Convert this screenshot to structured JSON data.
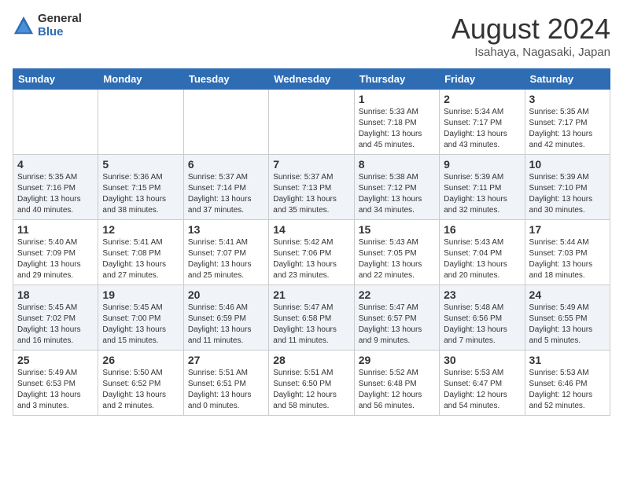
{
  "logo": {
    "general": "General",
    "blue": "Blue"
  },
  "header": {
    "title": "August 2024",
    "subtitle": "Isahaya, Nagasaki, Japan"
  },
  "days": [
    "Sunday",
    "Monday",
    "Tuesday",
    "Wednesday",
    "Thursday",
    "Friday",
    "Saturday"
  ],
  "weeks": [
    [
      {
        "date": "",
        "info": ""
      },
      {
        "date": "",
        "info": ""
      },
      {
        "date": "",
        "info": ""
      },
      {
        "date": "",
        "info": ""
      },
      {
        "date": "1",
        "info": "Sunrise: 5:33 AM\nSunset: 7:18 PM\nDaylight: 13 hours and 45 minutes."
      },
      {
        "date": "2",
        "info": "Sunrise: 5:34 AM\nSunset: 7:17 PM\nDaylight: 13 hours and 43 minutes."
      },
      {
        "date": "3",
        "info": "Sunrise: 5:35 AM\nSunset: 7:17 PM\nDaylight: 13 hours and 42 minutes."
      }
    ],
    [
      {
        "date": "4",
        "info": "Sunrise: 5:35 AM\nSunset: 7:16 PM\nDaylight: 13 hours and 40 minutes."
      },
      {
        "date": "5",
        "info": "Sunrise: 5:36 AM\nSunset: 7:15 PM\nDaylight: 13 hours and 38 minutes."
      },
      {
        "date": "6",
        "info": "Sunrise: 5:37 AM\nSunset: 7:14 PM\nDaylight: 13 hours and 37 minutes."
      },
      {
        "date": "7",
        "info": "Sunrise: 5:37 AM\nSunset: 7:13 PM\nDaylight: 13 hours and 35 minutes."
      },
      {
        "date": "8",
        "info": "Sunrise: 5:38 AM\nSunset: 7:12 PM\nDaylight: 13 hours and 34 minutes."
      },
      {
        "date": "9",
        "info": "Sunrise: 5:39 AM\nSunset: 7:11 PM\nDaylight: 13 hours and 32 minutes."
      },
      {
        "date": "10",
        "info": "Sunrise: 5:39 AM\nSunset: 7:10 PM\nDaylight: 13 hours and 30 minutes."
      }
    ],
    [
      {
        "date": "11",
        "info": "Sunrise: 5:40 AM\nSunset: 7:09 PM\nDaylight: 13 hours and 29 minutes."
      },
      {
        "date": "12",
        "info": "Sunrise: 5:41 AM\nSunset: 7:08 PM\nDaylight: 13 hours and 27 minutes."
      },
      {
        "date": "13",
        "info": "Sunrise: 5:41 AM\nSunset: 7:07 PM\nDaylight: 13 hours and 25 minutes."
      },
      {
        "date": "14",
        "info": "Sunrise: 5:42 AM\nSunset: 7:06 PM\nDaylight: 13 hours and 23 minutes."
      },
      {
        "date": "15",
        "info": "Sunrise: 5:43 AM\nSunset: 7:05 PM\nDaylight: 13 hours and 22 minutes."
      },
      {
        "date": "16",
        "info": "Sunrise: 5:43 AM\nSunset: 7:04 PM\nDaylight: 13 hours and 20 minutes."
      },
      {
        "date": "17",
        "info": "Sunrise: 5:44 AM\nSunset: 7:03 PM\nDaylight: 13 hours and 18 minutes."
      }
    ],
    [
      {
        "date": "18",
        "info": "Sunrise: 5:45 AM\nSunset: 7:02 PM\nDaylight: 13 hours and 16 minutes."
      },
      {
        "date": "19",
        "info": "Sunrise: 5:45 AM\nSunset: 7:00 PM\nDaylight: 13 hours and 15 minutes."
      },
      {
        "date": "20",
        "info": "Sunrise: 5:46 AM\nSunset: 6:59 PM\nDaylight: 13 hours and 11 minutes."
      },
      {
        "date": "21",
        "info": "Sunrise: 5:47 AM\nSunset: 6:58 PM\nDaylight: 13 hours and 11 minutes."
      },
      {
        "date": "22",
        "info": "Sunrise: 5:47 AM\nSunset: 6:57 PM\nDaylight: 13 hours and 9 minutes."
      },
      {
        "date": "23",
        "info": "Sunrise: 5:48 AM\nSunset: 6:56 PM\nDaylight: 13 hours and 7 minutes."
      },
      {
        "date": "24",
        "info": "Sunrise: 5:49 AM\nSunset: 6:55 PM\nDaylight: 13 hours and 5 minutes."
      }
    ],
    [
      {
        "date": "25",
        "info": "Sunrise: 5:49 AM\nSunset: 6:53 PM\nDaylight: 13 hours and 3 minutes."
      },
      {
        "date": "26",
        "info": "Sunrise: 5:50 AM\nSunset: 6:52 PM\nDaylight: 13 hours and 2 minutes."
      },
      {
        "date": "27",
        "info": "Sunrise: 5:51 AM\nSunset: 6:51 PM\nDaylight: 13 hours and 0 minutes."
      },
      {
        "date": "28",
        "info": "Sunrise: 5:51 AM\nSunset: 6:50 PM\nDaylight: 12 hours and 58 minutes."
      },
      {
        "date": "29",
        "info": "Sunrise: 5:52 AM\nSunset: 6:48 PM\nDaylight: 12 hours and 56 minutes."
      },
      {
        "date": "30",
        "info": "Sunrise: 5:53 AM\nSunset: 6:47 PM\nDaylight: 12 hours and 54 minutes."
      },
      {
        "date": "31",
        "info": "Sunrise: 5:53 AM\nSunset: 6:46 PM\nDaylight: 12 hours and 52 minutes."
      }
    ]
  ]
}
